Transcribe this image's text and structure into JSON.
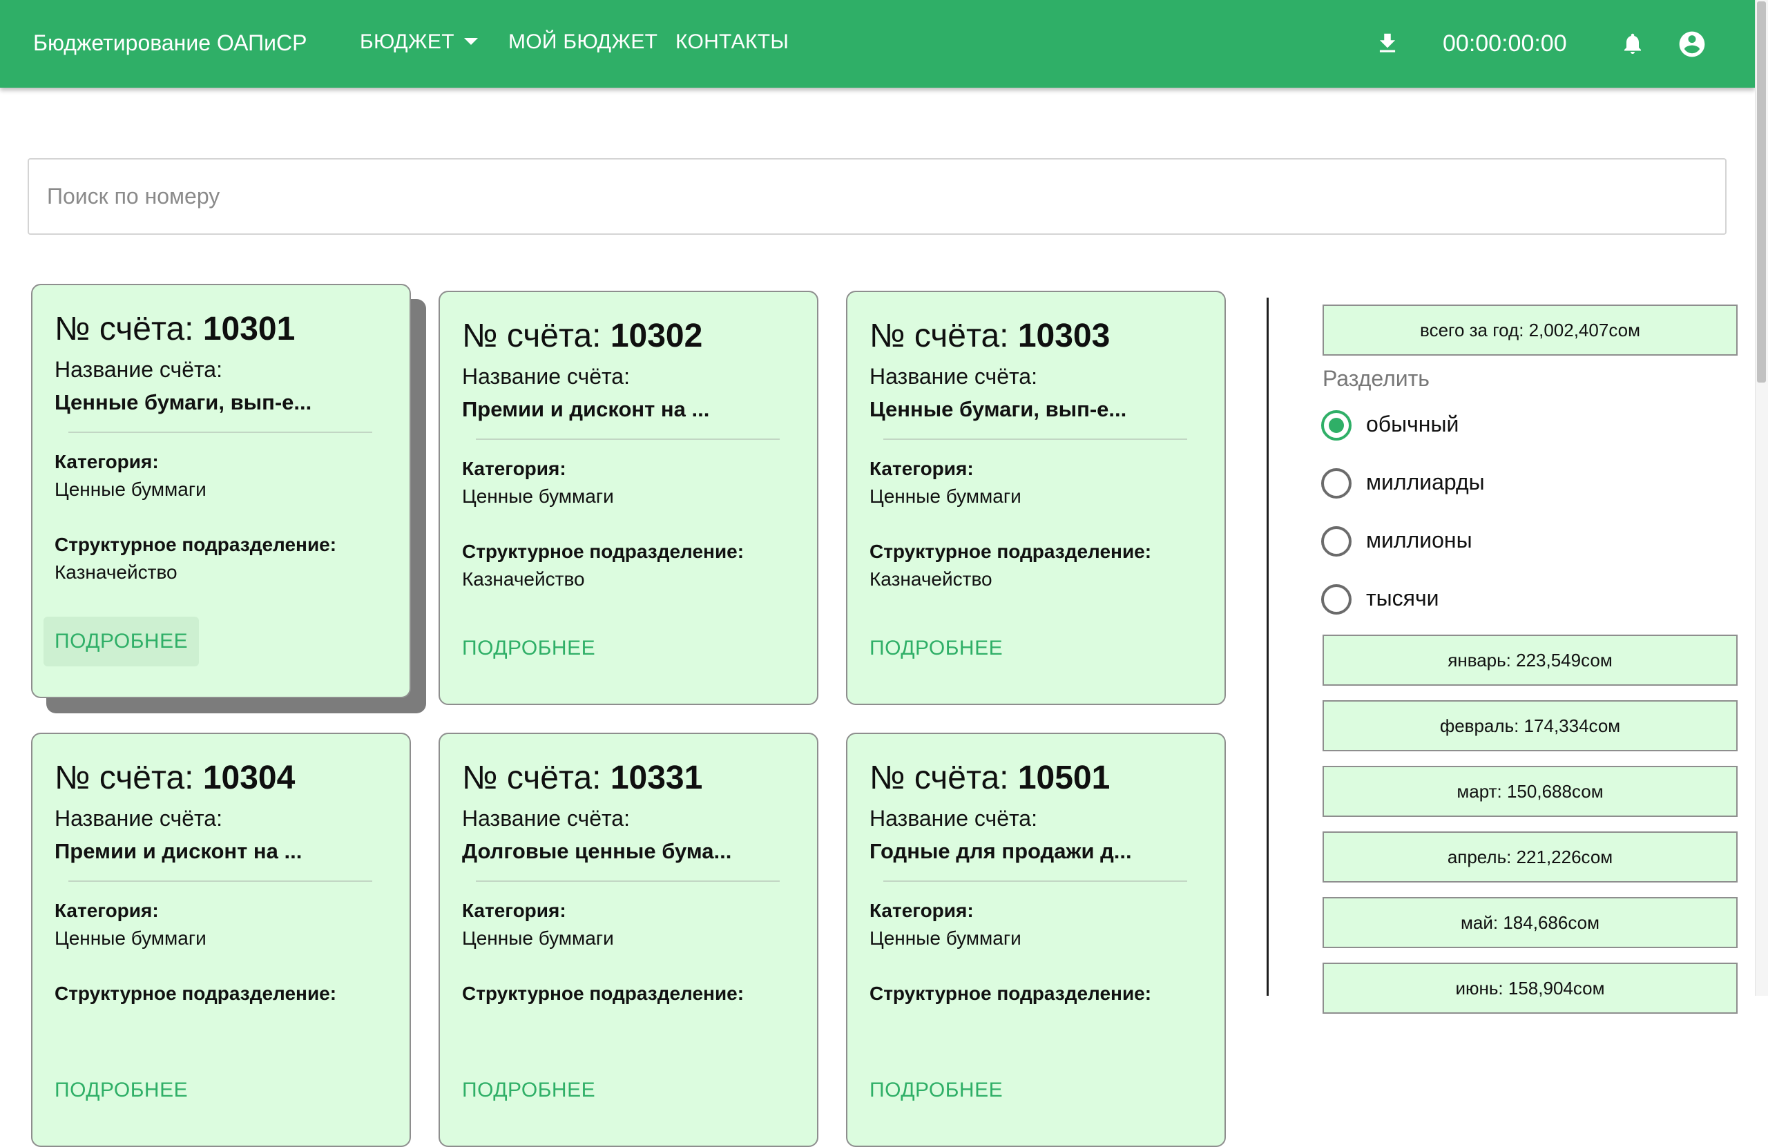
{
  "header": {
    "brand": "Бюджетирование ОАПиСР",
    "nav_budget": "БЮДЖЕТ",
    "nav_my_budget": "МОЙ БЮДЖЕТ",
    "nav_contacts": "КОНТАКТЫ",
    "timer": "00:00:00:00",
    "icons": [
      "download-icon",
      "bell-icon",
      "account-circle-icon",
      "chevron-down-icon"
    ],
    "accent_color": "#2faf67"
  },
  "search": {
    "placeholder": "Поиск по номеру",
    "value": ""
  },
  "card_labels": {
    "number_prefix": "№ счёта: ",
    "name_label": "Название счёта:",
    "category_label": "Категория:",
    "struct_label": "Структурное подразделение:",
    "more_button": "ПОДРОБНЕЕ"
  },
  "cards": [
    {
      "number": "10301",
      "name": "Ценные бумаги, вып-е...",
      "category": "Ценные буммаги",
      "struct": "Казначейство"
    },
    {
      "number": "10302",
      "name": "Премии и дисконт на ...",
      "category": "Ценные буммаги",
      "struct": "Казначейство"
    },
    {
      "number": "10303",
      "name": "Ценные бумаги, вып-е...",
      "category": "Ценные буммаги",
      "struct": "Казначейство"
    },
    {
      "number": "10304",
      "name": "Премии и дисконт на ...",
      "category": "Ценные буммаги",
      "struct": ""
    },
    {
      "number": "10331",
      "name": "Долговые ценные бума...",
      "category": "Ценные буммаги",
      "struct": ""
    },
    {
      "number": "10501",
      "name": "Годные для продажи д...",
      "category": "Ценные буммаги",
      "struct": ""
    }
  ],
  "sidebar": {
    "total": "всего за год: 2,002,407сом",
    "split_label": "Разделить",
    "split_options": [
      {
        "label": "обычный",
        "checked": true
      },
      {
        "label": "миллиарды",
        "checked": false
      },
      {
        "label": "миллионы",
        "checked": false
      },
      {
        "label": "тысячи",
        "checked": false
      }
    ],
    "months": [
      "январь: 223,549сом",
      "февраль: 174,334сом",
      "март: 150,688сом",
      "апрель: 221,226сом",
      "май: 184,686сом",
      "июнь: 158,904сом"
    ]
  }
}
